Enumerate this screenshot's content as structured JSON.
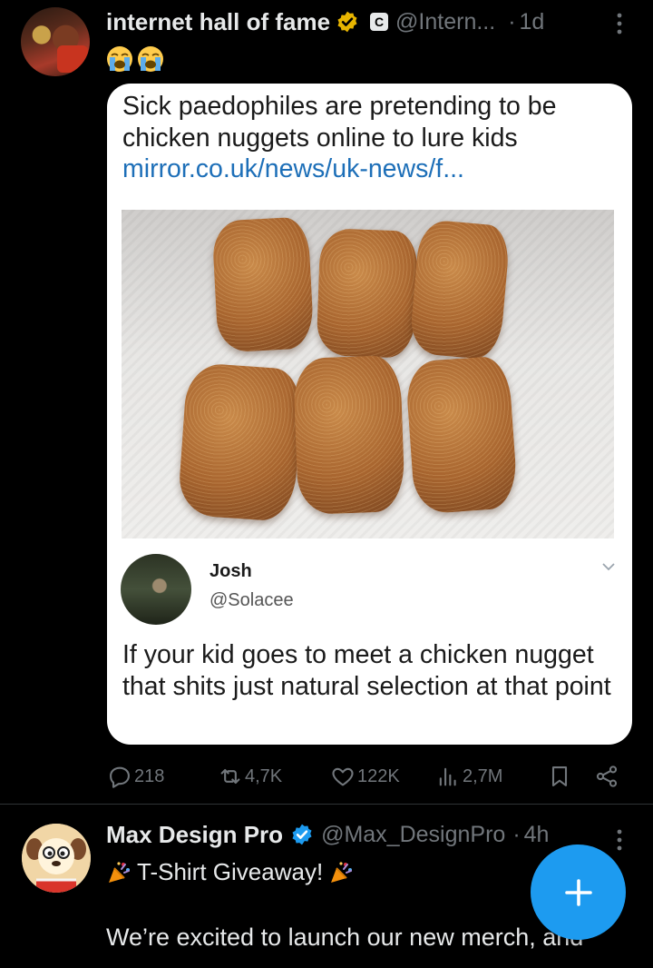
{
  "tweet1": {
    "author_name": "internet hall of fame",
    "badge_letter": "C",
    "handle": "@Intern...",
    "separator": "·",
    "time": "1d",
    "emoji_text": "😭😭",
    "card": {
      "headline": "Sick paedophiles are pretending to be chicken nuggets online to lure kids",
      "link": "mirror.co.uk/news/uk-news/f...",
      "quoted_name": "Josh",
      "quoted_handle": "@Solacee",
      "quoted_text": "If your kid goes to meet a chicken nugget that shits just natural selection at that point"
    },
    "actions": {
      "replies": "218",
      "reposts": "4,7K",
      "likes": "122K",
      "views": "2,7M"
    }
  },
  "tweet2": {
    "author_name": "Max Design Pro",
    "handle": "@Max_DesignPro",
    "separator": "·",
    "time": "4h",
    "line1": "T-Shirt Giveaway!",
    "body": "We’re excited to launch our new merch, and"
  },
  "colors": {
    "background": "#000000",
    "text_primary": "#e7e9ea",
    "text_secondary": "#71767b",
    "accent": "#1d9bf0",
    "gold_badge": "#e8b500",
    "link_blue": "#1d6fb8"
  },
  "icons": {
    "reply": "reply-icon",
    "repost": "repost-icon",
    "like": "heart-icon",
    "views": "views-icon",
    "bookmark": "bookmark-icon",
    "share": "share-icon",
    "compose": "plus-icon"
  }
}
